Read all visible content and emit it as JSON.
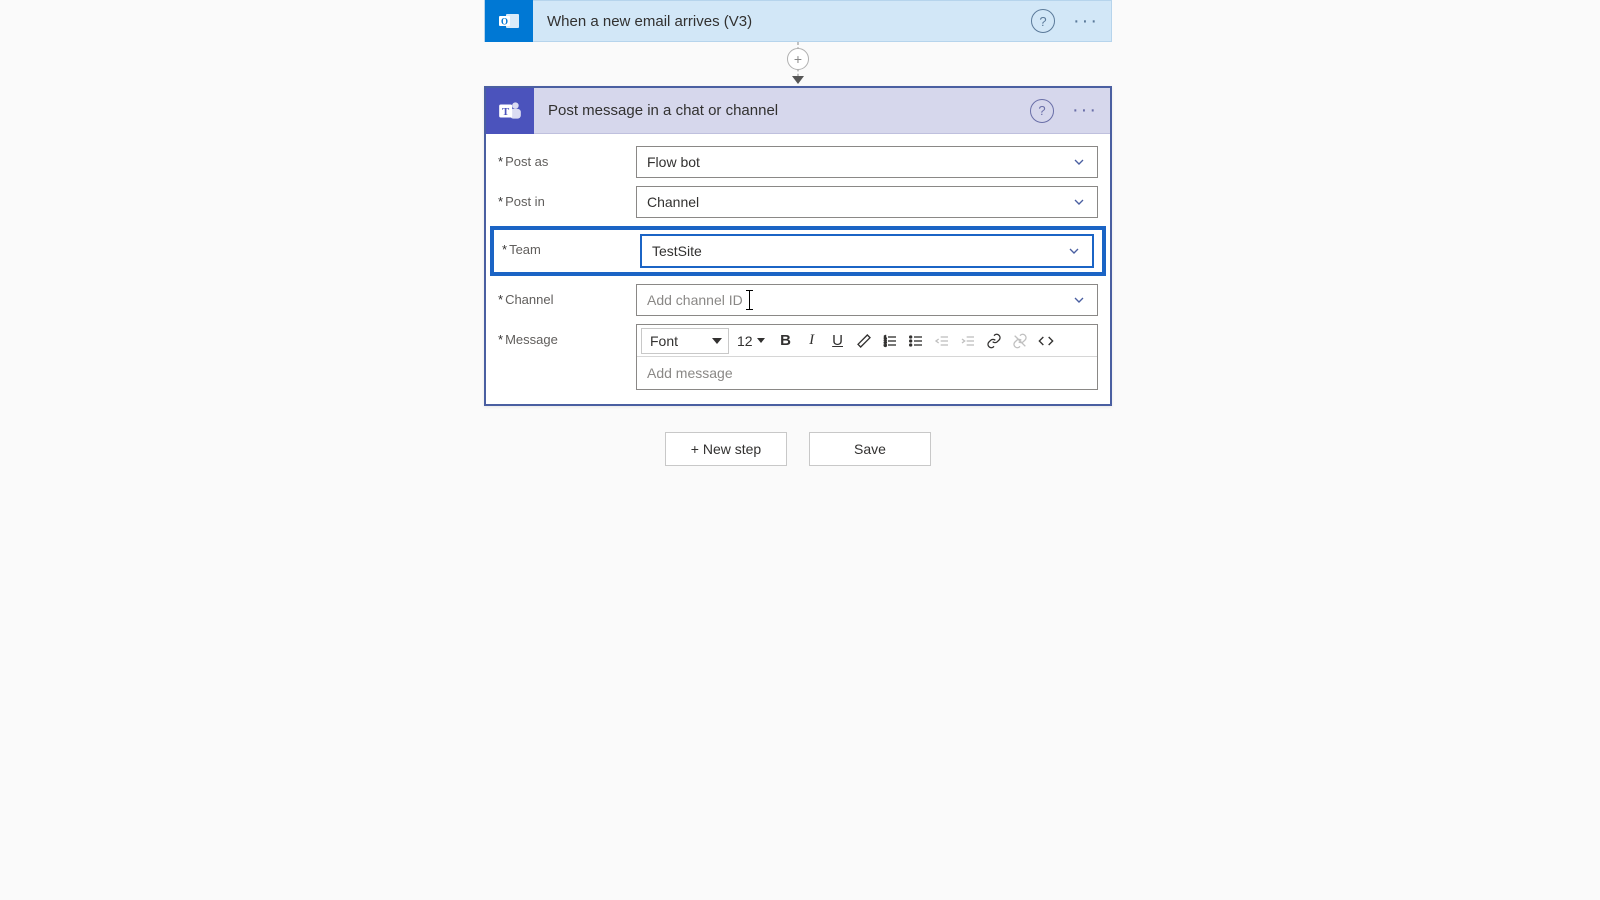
{
  "trigger": {
    "title": "When a new email arrives (V3)"
  },
  "action": {
    "title": "Post message in a chat or channel",
    "fields": {
      "postAsLabel": "Post as",
      "postAsValue": "Flow bot",
      "postInLabel": "Post in",
      "postInValue": "Channel",
      "teamLabel": "Team",
      "teamValue": "TestSite",
      "channelLabel": "Channel",
      "channelPlaceholder": "Add channel ID",
      "messageLabel": "Message",
      "messagePlaceholder": "Add message"
    },
    "toolbar": {
      "fontLabel": "Font",
      "fontSize": "12"
    }
  },
  "footer": {
    "newStep": "+ New step",
    "save": "Save"
  },
  "aria": {
    "help": "?",
    "more": "···",
    "plus": "+"
  }
}
